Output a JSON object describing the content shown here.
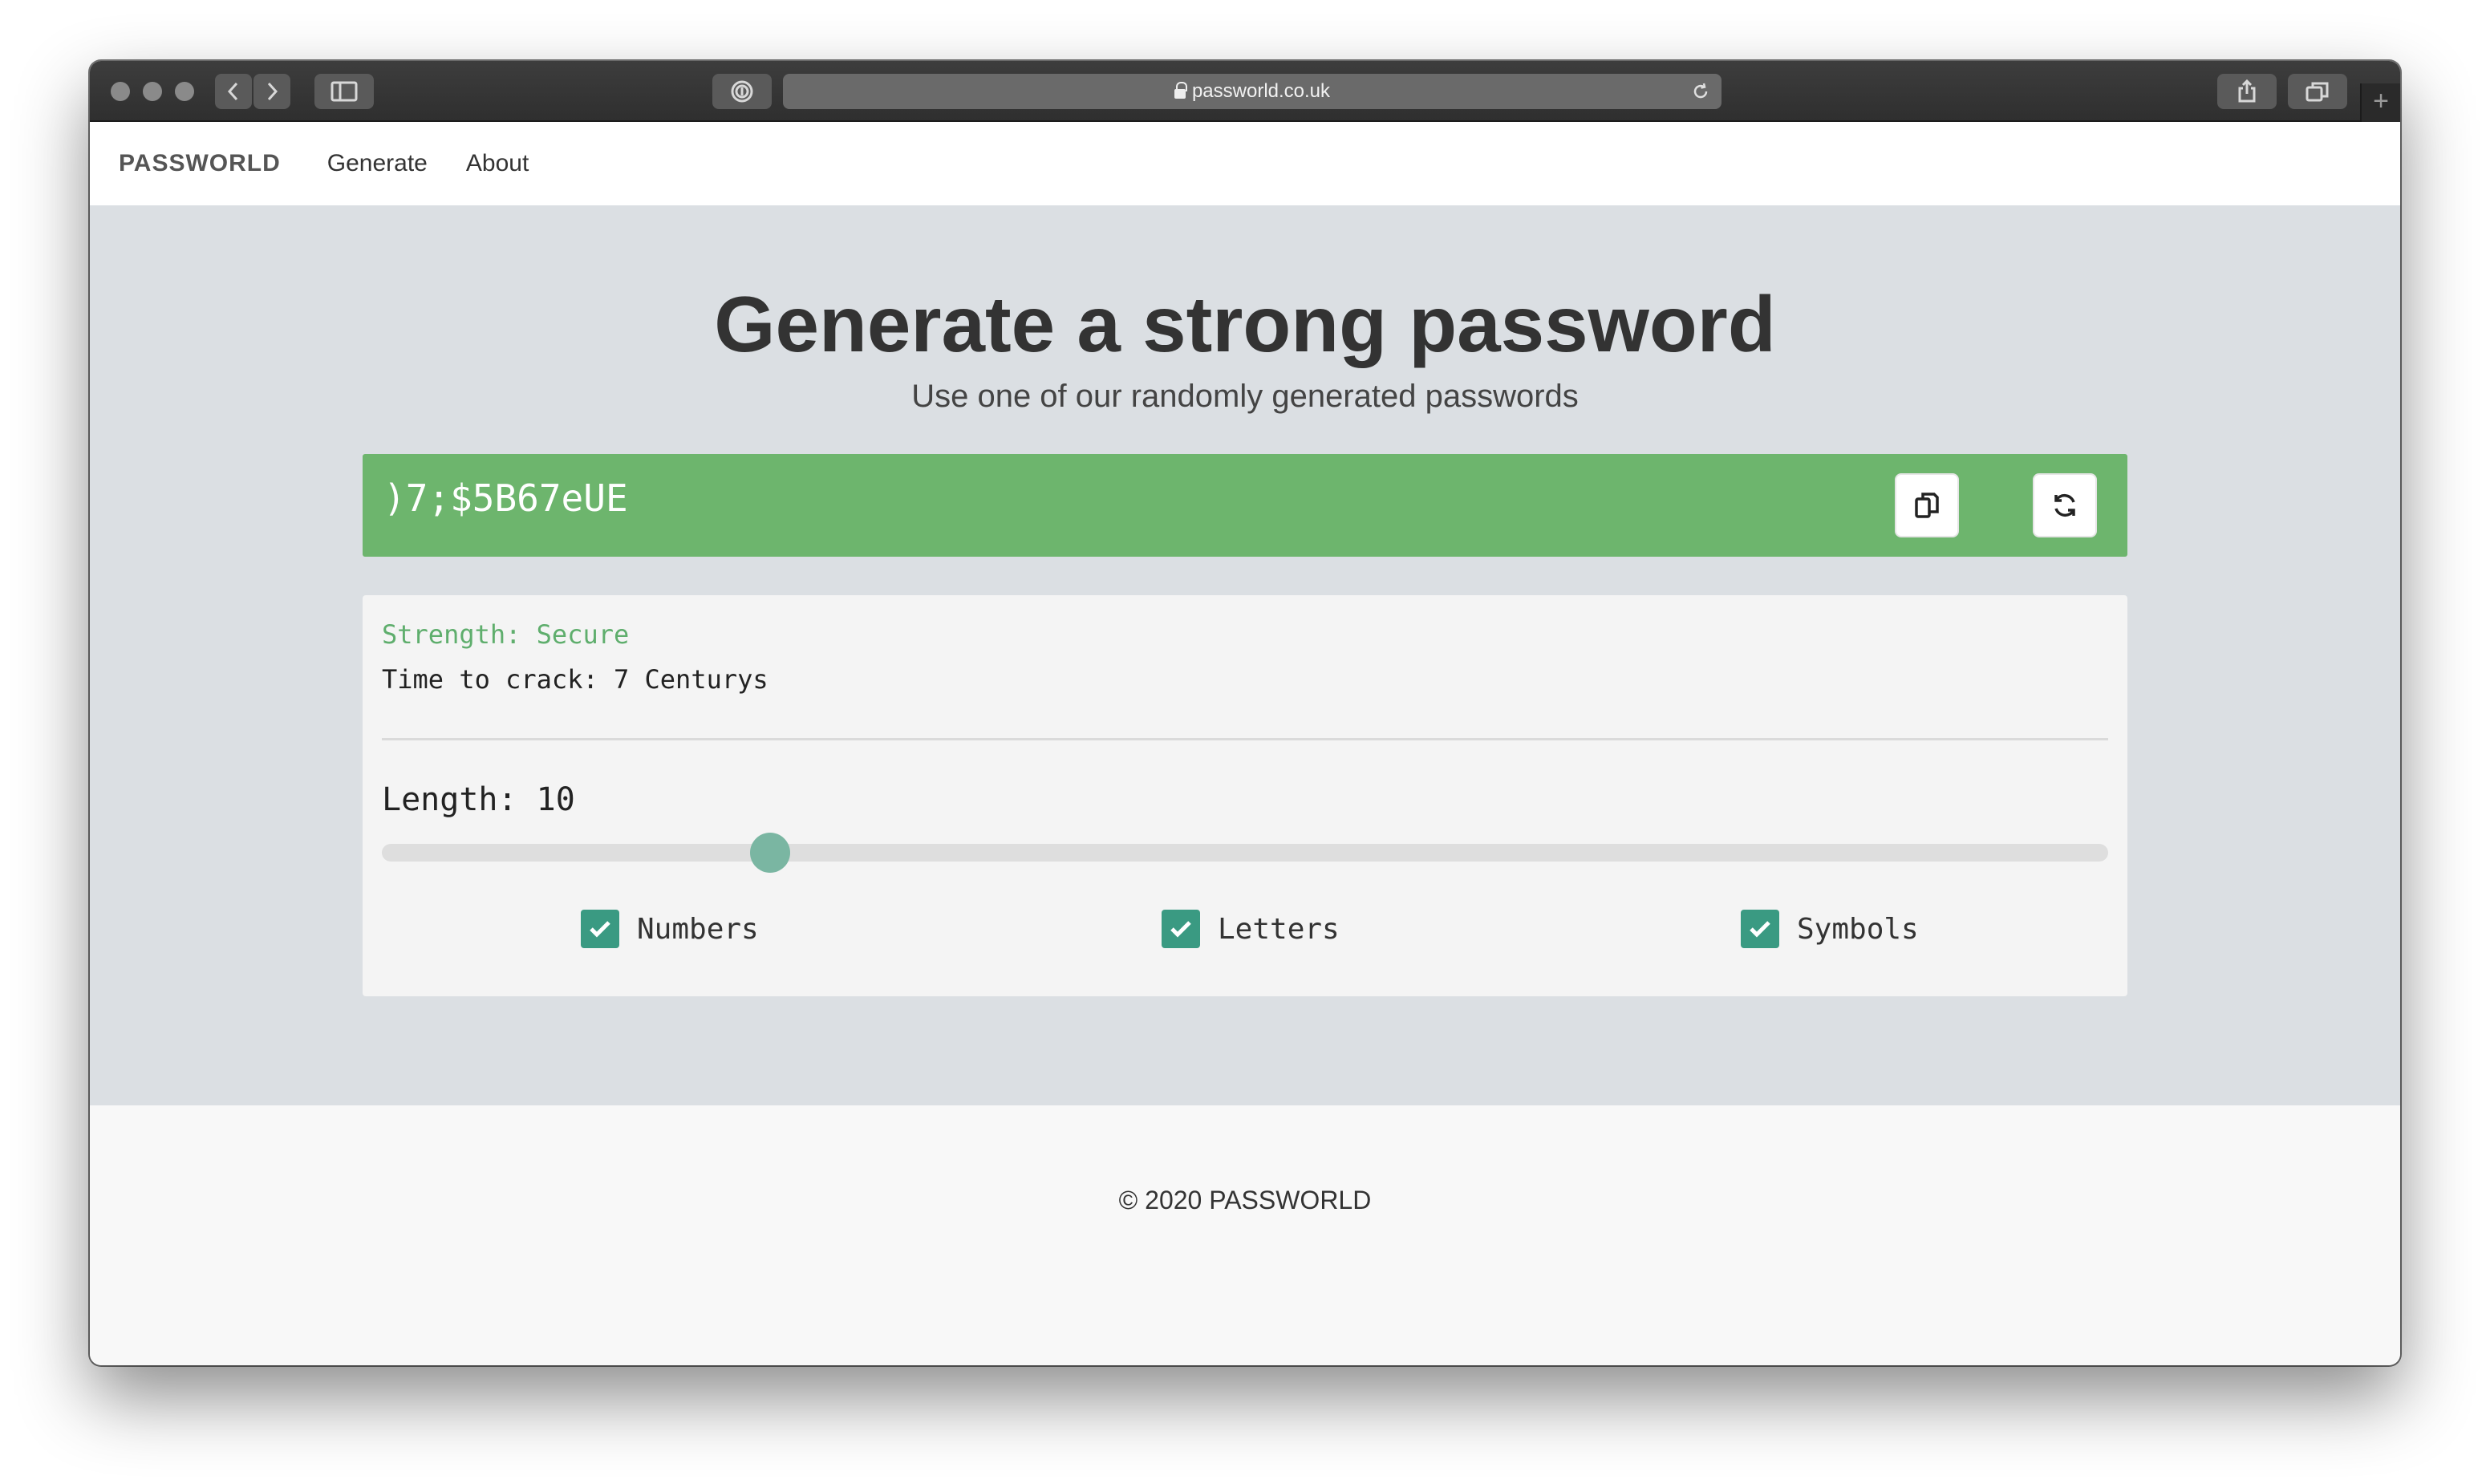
{
  "browser": {
    "url": "passworld.co.uk"
  },
  "navbar": {
    "brand": "PASSWORLD",
    "links": [
      "Generate",
      "About"
    ]
  },
  "hero": {
    "title": "Generate a strong password",
    "subtitle": "Use one of our randomly generated passwords"
  },
  "password": {
    "value": ")7;$5B67eUE",
    "copy_icon": "copy-icon",
    "refresh_icon": "refresh-icon",
    "bar_color": "#6db56d"
  },
  "strength": {
    "label": "Strength: Secure",
    "crack_time": "Time to crack: 7 Centurys",
    "color": "#5fae6d"
  },
  "options": {
    "length_label": "Length: 10",
    "length_fraction": 0.225,
    "checkboxes": [
      {
        "label": "Numbers",
        "checked": true
      },
      {
        "label": "Letters",
        "checked": true
      },
      {
        "label": "Symbols",
        "checked": true
      }
    ]
  },
  "footer": {
    "text": "© 2020 PASSWORLD"
  }
}
